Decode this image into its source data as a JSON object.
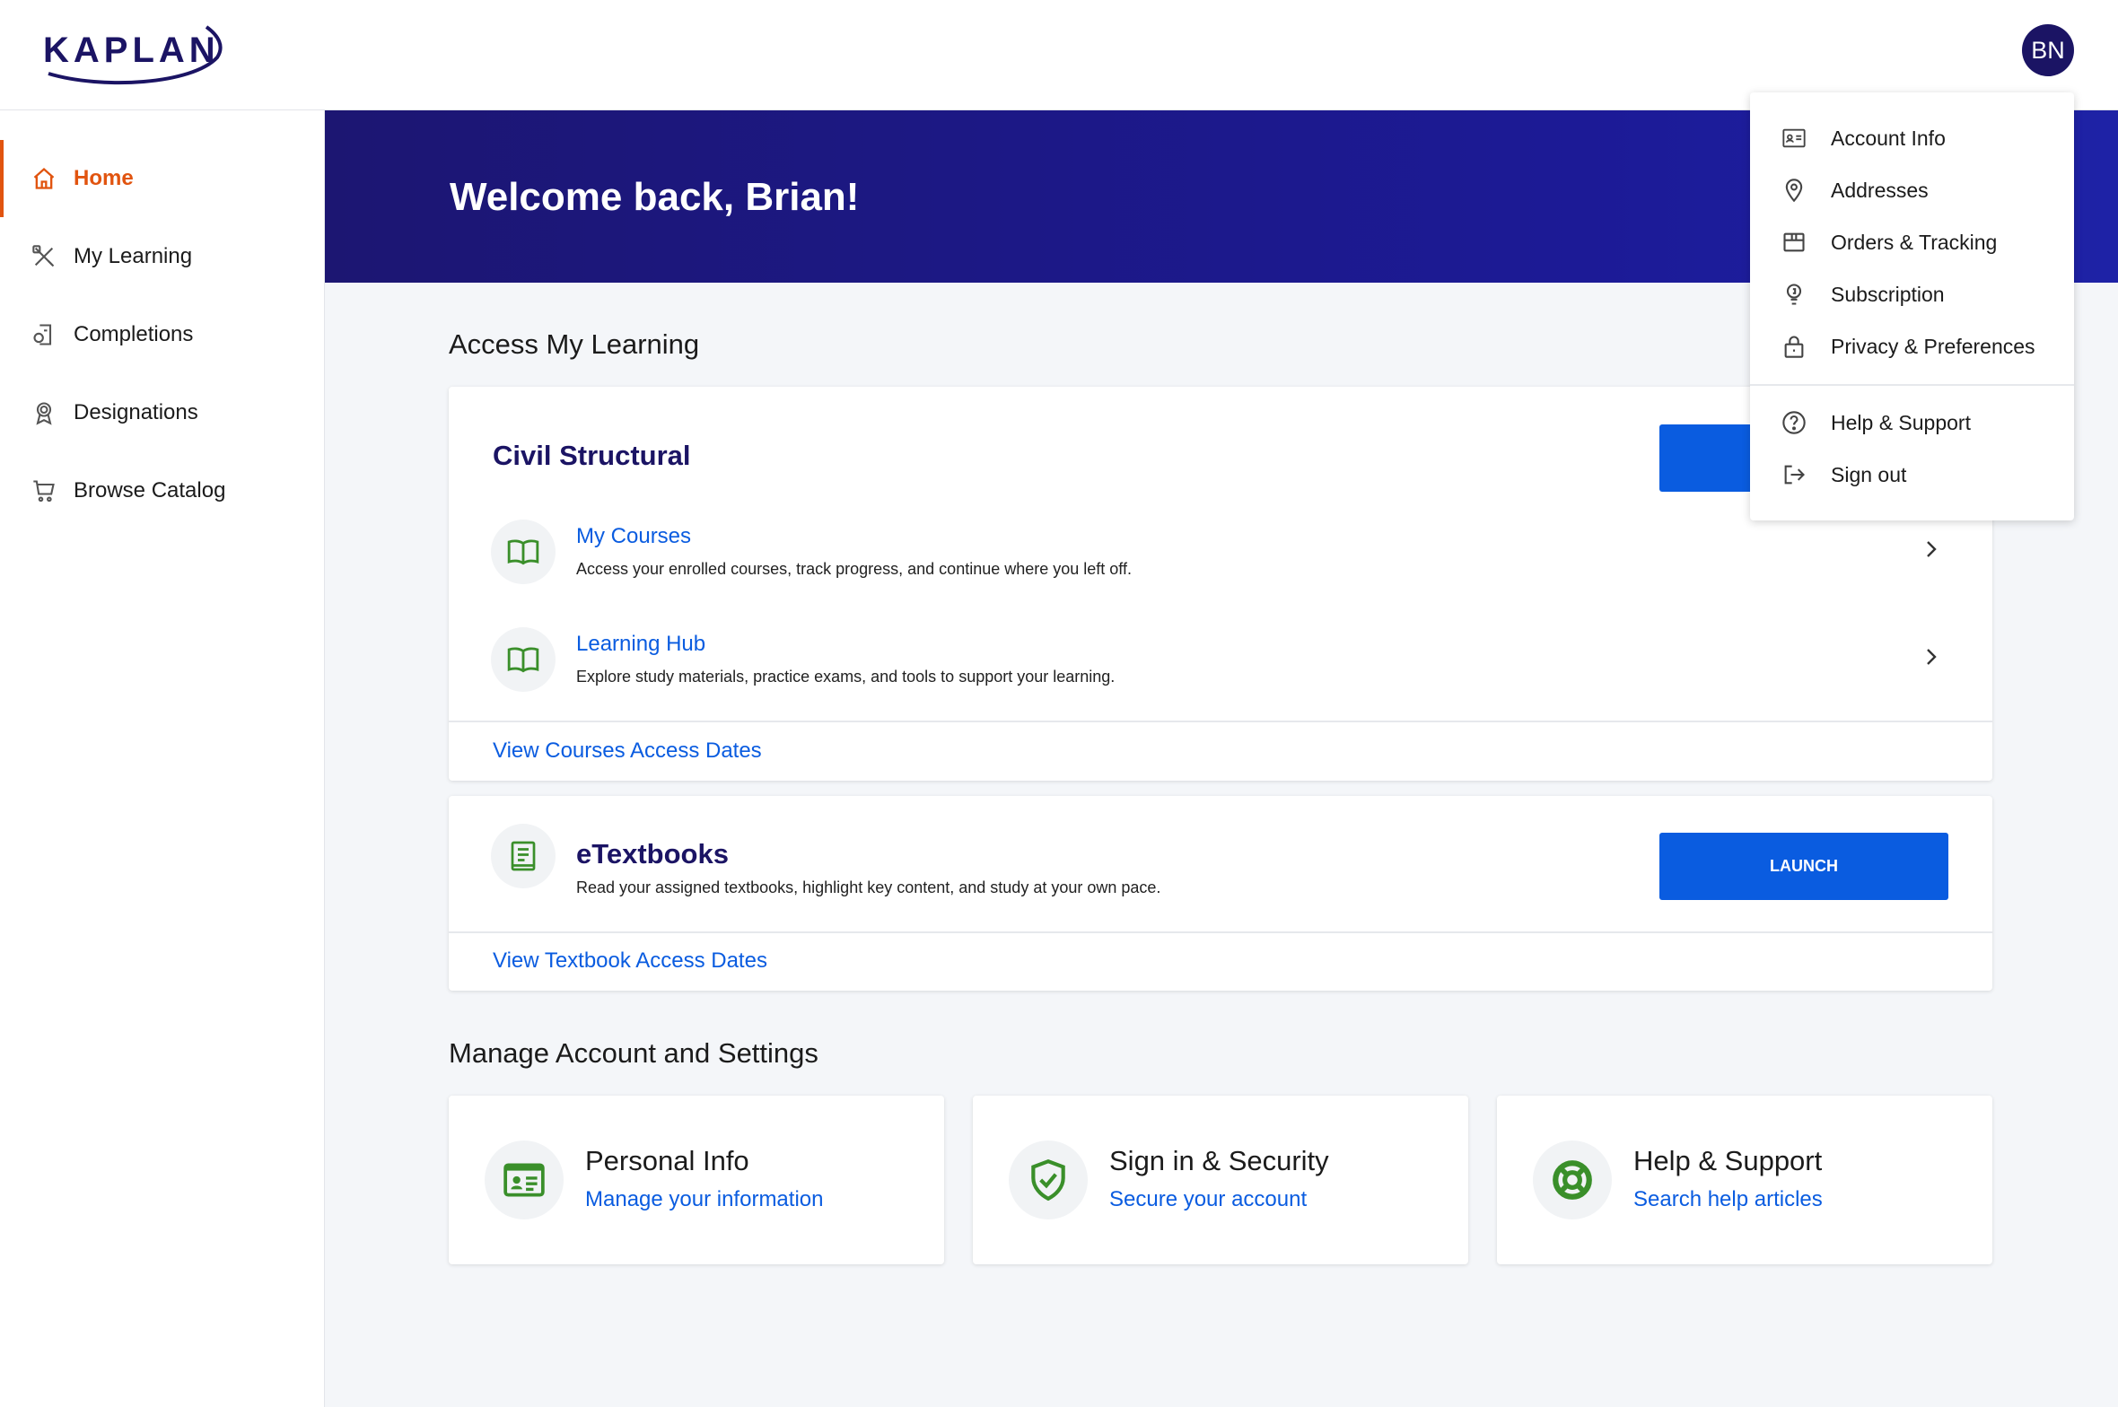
{
  "header": {
    "logo_text": "KAPLAN",
    "avatar_initials": "BN"
  },
  "sidebar": {
    "items": [
      {
        "label": "Home",
        "icon": "home-icon",
        "active": true
      },
      {
        "label": "My Learning",
        "icon": "tools-icon"
      },
      {
        "label": "Completions",
        "icon": "certificate-icon"
      },
      {
        "label": "Designations",
        "icon": "award-icon"
      },
      {
        "label": "Browse Catalog",
        "icon": "cart-icon"
      }
    ]
  },
  "banner": {
    "greeting": "Welcome back, Brian!"
  },
  "access": {
    "section_title": "Access My Learning",
    "program": {
      "title": "Civil Structural",
      "rows": [
        {
          "title": "My Courses",
          "desc": "Access your enrolled courses, track progress, and continue where you left off.",
          "icon": "book-open-icon"
        },
        {
          "title": "Learning Hub",
          "desc": "Explore study materials, practice exams, and tools to support your learning.",
          "icon": "book-open-icon"
        }
      ],
      "footer_link": "View Courses Access Dates"
    },
    "etextbooks": {
      "title": "eTextbooks",
      "desc": "Read your assigned textbooks, highlight key content, and study at your own pace.",
      "button": "LAUNCH",
      "footer_link": "View Textbook Access Dates"
    }
  },
  "settings": {
    "section_title": "Manage Account and Settings",
    "cards": [
      {
        "title": "Personal Info",
        "link": "Manage your information",
        "icon": "id-card-icon"
      },
      {
        "title": "Sign in & Security",
        "link": "Secure your account",
        "icon": "shield-check-icon"
      },
      {
        "title": "Help & Support",
        "link": "Search help articles",
        "icon": "lifebuoy-icon"
      }
    ]
  },
  "dropdown": {
    "items": [
      {
        "label": "Account Info",
        "icon": "id-card-icon"
      },
      {
        "label": "Addresses",
        "icon": "map-pin-icon"
      },
      {
        "label": "Orders & Tracking",
        "icon": "box-icon"
      },
      {
        "label": "Subscription",
        "icon": "lightbulb-icon"
      },
      {
        "label": "Privacy & Preferences",
        "icon": "lock-icon"
      },
      {
        "label": "Help & Support",
        "icon": "help-circle-icon"
      },
      {
        "label": "Sign out",
        "icon": "sign-out-icon"
      }
    ]
  },
  "colors": {
    "brand_navy": "#1b1464",
    "accent_orange": "#e1540f",
    "link_blue": "#0a5ce0",
    "icon_green": "#3a8f2a"
  }
}
